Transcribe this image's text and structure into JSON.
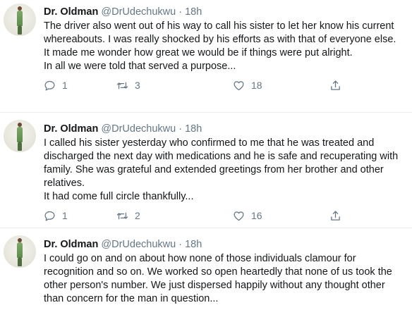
{
  "tweets": [
    {
      "name": "Dr. Oldman",
      "handle": "@DrUdechukwu",
      "separator": "·",
      "time": "18h",
      "lines": [
        "The driver also went out of his way to call his sister to let her know his current whereabouts. I was really shocked by his efforts as with that of everyone else.",
        "It made me wonder how great we would be if things were put alright.",
        "In all we were told that served a purpose..."
      ],
      "replies": "1",
      "retweets": "3",
      "likes": "18"
    },
    {
      "name": "Dr. Oldman",
      "handle": "@DrUdechukwu",
      "separator": "·",
      "time": "18h",
      "lines": [
        "I called his sister yesterday who confirmed to me that he was treated and discharged the next day with medications and he is safe and recuperating with family. She was grateful and extended greetings from her brother and other relatives.",
        "It had come full circle thankfully..."
      ],
      "replies": "1",
      "retweets": "2",
      "likes": "16"
    },
    {
      "name": "Dr. Oldman",
      "handle": "@DrUdechukwu",
      "separator": "·",
      "time": "18h",
      "lines": [
        "I could go on and on about how none of those individuals clamour for recognition and so on. We worked so open heartedly that none of us took the other person's number. We just dispersed happily without any thought other than concern for the man in question..."
      ]
    }
  ],
  "icons": {
    "reply": "reply-icon",
    "retweet": "retweet-icon",
    "like": "heart-icon",
    "share": "share-icon"
  },
  "colors": {
    "text": "#14171a",
    "muted": "#657786",
    "divider": "#e6ecf0"
  }
}
